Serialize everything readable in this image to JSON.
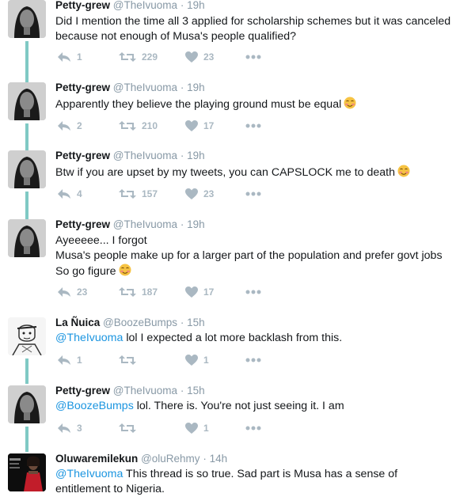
{
  "tweets": [
    {
      "name": "Petty-grew",
      "handle": "@TheIvuoma",
      "time": "19h",
      "lines": [
        "Did I mention the time all 3 applied for scholarship schemes but it was canceled",
        "because not enough of Musa's people qualified?"
      ],
      "replies": "1",
      "retweets": "229",
      "likes": "23"
    },
    {
      "name": "Petty-grew",
      "handle": "@TheIvuoma",
      "time": "19h",
      "lines": [
        "Apparently they believe the playing ground must be equal"
      ],
      "emoji_line": 0,
      "replies": "2",
      "retweets": "210",
      "likes": "17"
    },
    {
      "name": "Petty-grew",
      "handle": "@TheIvuoma",
      "time": "19h",
      "lines": [
        "Btw if you are upset by my tweets, you can CAPSLOCK me to death"
      ],
      "emoji_line": 0,
      "replies": "4",
      "retweets": "157",
      "likes": "23"
    },
    {
      "name": "Petty-grew",
      "handle": "@TheIvuoma",
      "time": "19h",
      "lines": [
        "Ayeeeee... I forgot",
        "Musa's people make up for a larger part of the population and prefer govt jobs",
        "So go figure"
      ],
      "emoji_line": 2,
      "replies": "23",
      "retweets": "187",
      "likes": "17"
    },
    {
      "name": "La Ñuica",
      "handle": "@BoozeBumps",
      "time": "15h",
      "mention": "@TheIvuoma",
      "lines": [
        " lol I expected a lot more backlash from this."
      ],
      "replies": "1",
      "retweets": "",
      "likes": "1"
    },
    {
      "name": "Petty-grew",
      "handle": "@TheIvuoma",
      "time": "15h",
      "mention": "@BoozeBumps",
      "lines": [
        " lol. There is. You're not just seeing it. I am"
      ],
      "replies": "3",
      "retweets": "",
      "likes": "1"
    },
    {
      "name": "Oluwaremilekun",
      "handle": "@oluRehmy",
      "time": "14h",
      "mention": "@TheIvuoma",
      "lines": [
        " This thread is so true. Sad part is Musa has a sense of",
        "entitlement to Nigeria."
      ]
    }
  ],
  "separator": "·",
  "icons": {
    "reply": "reply-icon",
    "retweet": "retweet-icon",
    "like": "heart-icon",
    "more": "more-icon",
    "emoji": "smiling-face-emoji"
  },
  "colors": {
    "thread_line": "#7fc9c4",
    "mention": "#1b95e0",
    "muted": "#8899a6",
    "icon": "#aab8c2"
  }
}
